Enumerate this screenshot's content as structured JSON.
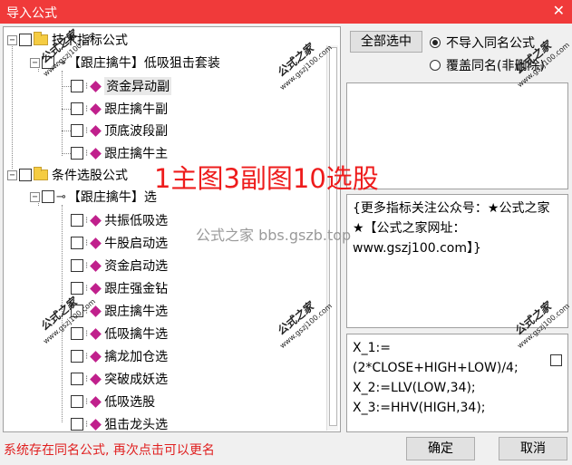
{
  "window": {
    "title": "导入公式"
  },
  "tree": [
    {
      "name": "技术指标公式",
      "type": "folder",
      "children": [
        {
          "name": "【跟庄擒牛】低吸狙击套装",
          "type": "group",
          "children": [
            "资金异动副",
            "跟庄擒牛副",
            "顶底波段副",
            "跟庄擒牛主"
          ]
        }
      ]
    },
    {
      "name": "条件选股公式",
      "type": "folder",
      "children": [
        {
          "name": "【跟庄擒牛】选",
          "type": "group",
          "children": [
            "共振低吸选",
            "牛股启动选",
            "资金启动选",
            "跟庄强金钻",
            "跟庄擒牛选",
            "低吸擒牛选",
            "擒龙加仓选",
            "突破成妖选",
            "低吸选股",
            "狙击龙头选"
          ]
        }
      ]
    }
  ],
  "buttons": {
    "select_all": "全部选中",
    "ok": "确定",
    "cancel": "取消"
  },
  "options": [
    {
      "label": "不导入同名公式",
      "selected": true
    },
    {
      "label": "覆盖同名(非删除)",
      "selected": false
    }
  ],
  "description": "{更多指标关注公众号：★公式之家★【公式之家网址：www.gszj100.com】}",
  "code": "X_1:=(2*CLOSE+HIGH+LOW)/4;\nX_2:=LLV(LOW,34);\nX_3:=HHV(HIGH,34);",
  "status": "系统存在同名公式, 再次点击可以更名",
  "overlay": {
    "banner": "1主图3副图10选股",
    "site": "公式之家 bbs.gszb.top"
  },
  "watermark": {
    "line1": "公式之家",
    "line2": "www.gszj100.com"
  },
  "colors": {
    "titlebar": "#f03a3a",
    "banner": "#ee1c1c",
    "status": "#e02020",
    "diamond": "#c0208c"
  }
}
